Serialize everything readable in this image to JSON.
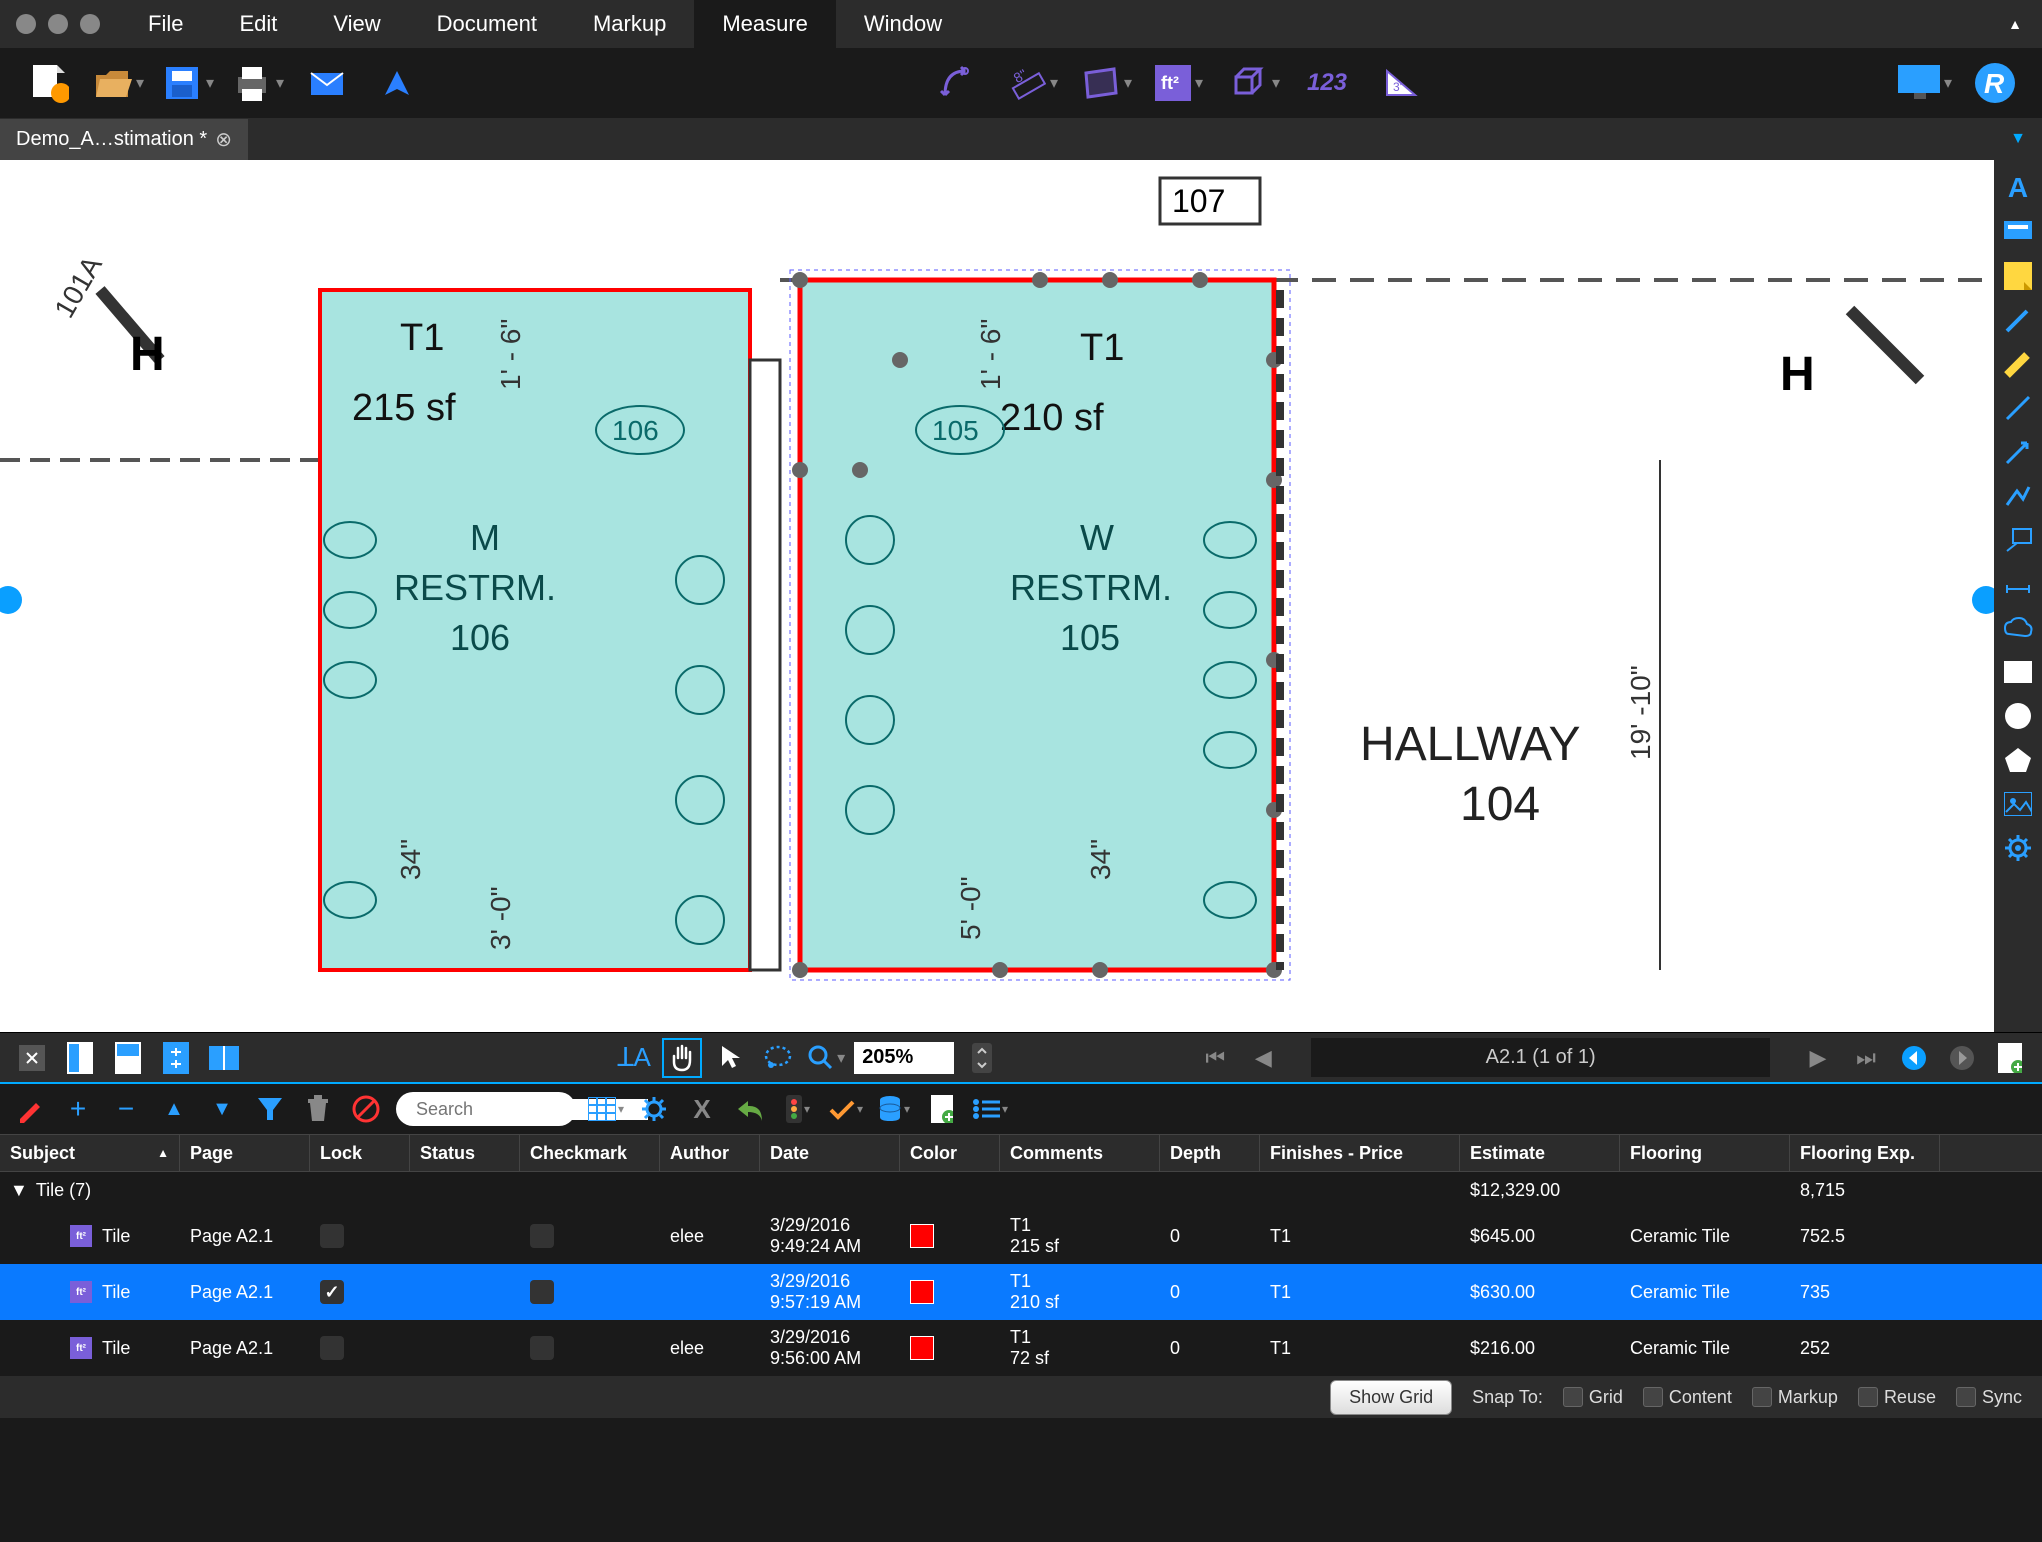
{
  "menubar": [
    "File",
    "Edit",
    "View",
    "Document",
    "Markup",
    "Measure",
    "Window"
  ],
  "active_menu": "Measure",
  "doc_tab": "Demo_A…stimation *",
  "zoom": "205%",
  "page_display": "A2.1 (1 of 1)",
  "search_placeholder": "Search",
  "floor": {
    "room1": {
      "tag": "T1",
      "area": "215 sf",
      "name_l1": "M",
      "name_l2": "RESTRM.",
      "num": "106"
    },
    "room_106": "106",
    "room_105": "105",
    "room2": {
      "tag": "T1",
      "area": "210 sf",
      "name_l1": "W",
      "name_l2": "RESTRM.",
      "num": "105"
    },
    "hallway": {
      "name": "HALLWAY",
      "num": "104"
    },
    "dim_19_10": "19' -10\"",
    "dim_101a": "101A",
    "dim_107": "107",
    "dim_34_a": "34\"",
    "dim_34_b": "34\"",
    "dim_5_0": "5' -0\"",
    "dim_3_0": "3' -0\"",
    "dim_1_6a": "1' - 6\"",
    "dim_1_6b": "1' - 6\""
  },
  "columns": [
    "Subject",
    "Page",
    "Lock",
    "Status",
    "Checkmark",
    "Author",
    "Date",
    "Color",
    "Comments",
    "Depth",
    "Finishes - Price",
    "Estimate",
    "Flooring",
    "Flooring Exp."
  ],
  "summary": {
    "subject": "Tile (7)",
    "estimate": "$12,329.00",
    "flooringexp": "8,715"
  },
  "rows": [
    {
      "subject": "Tile",
      "page": "Page A2.1",
      "lock": false,
      "author": "elee",
      "date_l1": "3/29/2016",
      "date_l2": "9:49:24 AM",
      "comments_l1": "T1",
      "comments_l2": "215 sf",
      "depth": "0",
      "finishes": "T1",
      "estimate": "$645.00",
      "flooring": "Ceramic Tile",
      "flooringexp": "752.5",
      "selected": false
    },
    {
      "subject": "Tile",
      "page": "Page A2.1",
      "lock": true,
      "author": "",
      "date_l1": "3/29/2016",
      "date_l2": "9:57:19 AM",
      "comments_l1": "T1",
      "comments_l2": "210 sf",
      "depth": "0",
      "finishes": "T1",
      "estimate": "$630.00",
      "flooring": "Ceramic Tile",
      "flooringexp": "735",
      "selected": true
    },
    {
      "subject": "Tile",
      "page": "Page A2.1",
      "lock": false,
      "author": "elee",
      "date_l1": "3/29/2016",
      "date_l2": "9:56:00 AM",
      "comments_l1": "T1",
      "comments_l2": "72 sf",
      "depth": "0",
      "finishes": "T1",
      "estimate": "$216.00",
      "flooring": "Ceramic Tile",
      "flooringexp": "252",
      "selected": false
    }
  ],
  "status": {
    "show_grid": "Show Grid",
    "snap_to": "Snap To:",
    "checks": [
      "Grid",
      "Content",
      "Markup",
      "Reuse",
      "Sync"
    ]
  },
  "toolbar_text": "123"
}
